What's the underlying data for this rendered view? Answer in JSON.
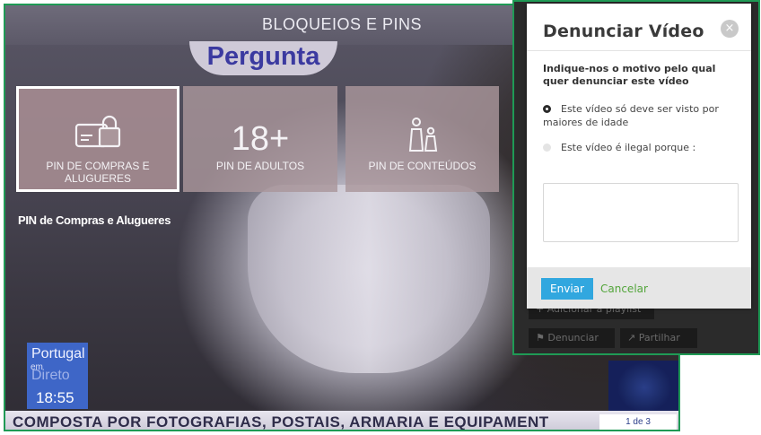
{
  "tv": {
    "menu_title": "BLOQUEIOS E PINS",
    "logo_text": "Pergunta",
    "cards": [
      {
        "label": "PIN DE COMPRAS E ALUGUERES",
        "icon": "credit-card-lock-icon",
        "big": ""
      },
      {
        "label": "PIN DE ADULTOS",
        "icon": "",
        "big": "18+"
      },
      {
        "label": "PIN DE CONTEÚDOS",
        "icon": "people-icon",
        "big": ""
      }
    ],
    "selected_caption": "PIN de Compras e Alugueres",
    "channel_logo": {
      "line1": "Portugal",
      "line2": "em",
      "line3": "Direto"
    },
    "clock": "18:55",
    "ticker": "COMPOSTA POR FOTOGRAFIAS, POSTAIS, ARMARIA E EQUIPAMENT",
    "ticker_page": "1 de 3"
  },
  "panel": {
    "background_buttons": {
      "add_playlist": "+ Adicionar à playlist",
      "report": "Denunciar",
      "share": "Partilhar"
    },
    "dialog": {
      "title": "Denunciar Vídeo",
      "question": "Indique-nos o motivo pelo qual quer denunciar este vídeo",
      "options": [
        {
          "text": "Este vídeo só deve ser visto por maiores de idade",
          "selected": true
        },
        {
          "text": "Este vídeo é ilegal porque :",
          "selected": false
        }
      ],
      "reason_value": "",
      "send_label": "Enviar",
      "cancel_label": "Cancelar"
    },
    "colors": {
      "accent": "#31a7df",
      "cancel": "#53a53b",
      "frame": "#1f9a55"
    }
  }
}
